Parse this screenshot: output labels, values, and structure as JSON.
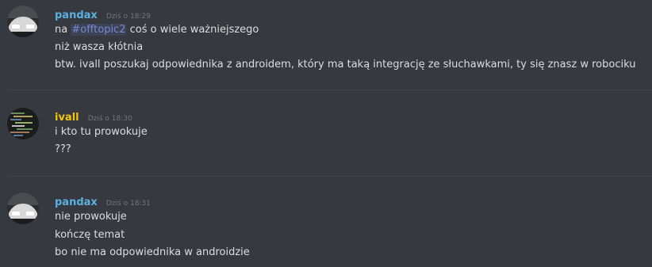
{
  "colors": {
    "background": "#36393f",
    "text": "#dcddde",
    "timestamp": "#72767d",
    "divider": "#42454a",
    "pandax_color": "#5bb0e0",
    "ivall_color": "#f1c40f",
    "channel_mention": "#7289da"
  },
  "messages": [
    {
      "author": "pandax",
      "timestamp": "Dziś o 18:29",
      "avatar_icon": "car-avatar-icon",
      "lines": [
        {
          "before": "na ",
          "mention": "#offtopic2",
          "after": " coś o wiele ważniejszego"
        },
        {
          "text": "niż wasza kłótnia"
        },
        {
          "text": "btw. ivall poszukaj odpowiednika z androidem, który ma taką integrację ze słuchawkami, ty się znasz w robociku"
        }
      ]
    },
    {
      "author": "ivall",
      "timestamp": "Dziś o 18:30",
      "avatar_icon": "code-screen-avatar-icon",
      "lines": [
        {
          "text": "i kto tu prowokuje"
        },
        {
          "text": "???"
        }
      ]
    },
    {
      "author": "pandax",
      "timestamp": "Dziś o 18:31",
      "avatar_icon": "car-avatar-icon",
      "lines": [
        {
          "text": "nie prowokuje"
        },
        {
          "text": "kończę temat"
        },
        {
          "text": "bo nie ma odpowiednika w androidzie"
        }
      ]
    }
  ]
}
